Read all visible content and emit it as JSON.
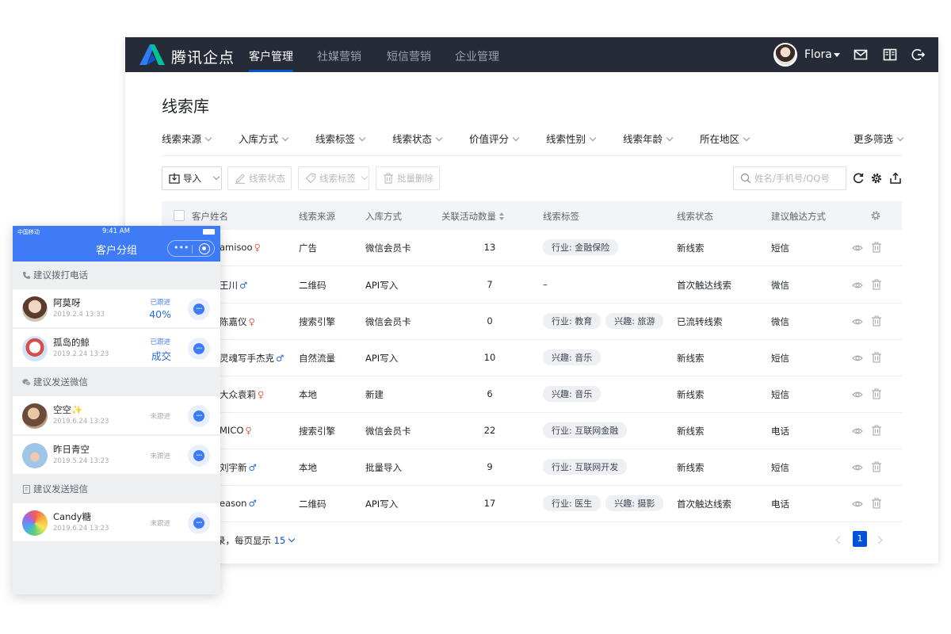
{
  "app": {
    "brand": "腾讯企点",
    "nav_tabs": [
      "客户管理",
      "社媒营销",
      "短信营销",
      "企业管理"
    ],
    "active_tab": "客户管理",
    "user_name": "Flora",
    "accent_color": "#0052d9",
    "nav_bg_color": "#252b37"
  },
  "page": {
    "title": "线索库",
    "filters": [
      "线索来源",
      "入库方式",
      "线索标签",
      "线索状态",
      "价值评分",
      "线索性别",
      "线索年龄",
      "所在地区"
    ],
    "more_filters": "更多筛选",
    "toolbar": {
      "import": "导入",
      "lead_status": "线索状态",
      "lead_tags": "线索标签",
      "batch_delete": "批量删除"
    },
    "search_placeholder": "姓名/手机号/QQ号"
  },
  "table": {
    "headers": {
      "name": "客户姓名",
      "source": "线索来源",
      "method": "入库方式",
      "activity": "关联活动数量",
      "tags": "线索标签",
      "status": "线索状态",
      "contact": "建议触达方式"
    },
    "rows": [
      {
        "name": "amisoo",
        "gender": "♀",
        "source": "广告",
        "method": "微信会员卡",
        "activity": "13",
        "tags": [
          "行业: 金融保险"
        ],
        "status": "新线索",
        "contact": "短信"
      },
      {
        "name": "王川",
        "gender": "♂",
        "source": "二维码",
        "method": "API写入",
        "activity": "7",
        "tags": [],
        "empty_tag": "–",
        "status": "首次触达线索",
        "contact": "微信"
      },
      {
        "name": "陈嘉仪",
        "gender": "♀",
        "source": "搜索引擎",
        "method": "微信会员卡",
        "activity": "0",
        "tags": [
          "行业: 教育",
          "兴趣: 旅游"
        ],
        "status": "已流转线索",
        "contact": "微信"
      },
      {
        "name": "灵魂写手杰克",
        "gender": "♂",
        "source": "自然流量",
        "method": "API写入",
        "activity": "10",
        "tags": [
          "兴趣: 音乐"
        ],
        "status": "新线索",
        "contact": "短信"
      },
      {
        "name": "大众袁莉",
        "gender": "♀",
        "source": "本地",
        "method": "新建",
        "activity": "6",
        "tags": [
          "兴趣: 音乐"
        ],
        "status": "新线索",
        "contact": "短信"
      },
      {
        "name": "MICO",
        "gender": "♀",
        "source": "搜索引擎",
        "method": "微信会员卡",
        "activity": "22",
        "tags": [
          "行业: 互联网金融"
        ],
        "status": "新线索",
        "contact": "电话"
      },
      {
        "name": "刘宇新",
        "gender": "♂",
        "source": "本地",
        "method": "批量导入",
        "activity": "9",
        "tags": [
          "行业: 互联网开发"
        ],
        "status": "新线索",
        "contact": "短信"
      },
      {
        "name": "eason",
        "gender": "♂",
        "source": "二维码",
        "method": "API写入",
        "activity": "17",
        "tags": [
          "行业: 医生",
          "兴趣: 摄影"
        ],
        "status": "首次触达线索",
        "contact": "电话"
      }
    ]
  },
  "pagination": {
    "summary": "录，每页显示",
    "page_size": "15",
    "current_page": "1"
  },
  "phone": {
    "carrier": "中国移动",
    "time": "9:41 AM",
    "title": "客户分组",
    "header_color": "#3e7bf6",
    "sections": [
      {
        "label": "建议拨打电话",
        "icon": "phone-icon",
        "items": [
          {
            "name": "阿莫呀",
            "date": "2019.2.4 13:33",
            "status_small": "已跟进",
            "status_big": "40%"
          },
          {
            "name": "孤岛的鲸",
            "date": "2019.2.24 13:23",
            "status_small": "已跟进",
            "status_big": "成交"
          }
        ]
      },
      {
        "label": "建议发送微信",
        "icon": "wechat-icon",
        "items": [
          {
            "name": "空空✨",
            "date": "2019.6.24 13:23",
            "status": "未跟进"
          },
          {
            "name": "昨日青空",
            "date": "2019.5.24 13:23",
            "status": "未跟进"
          }
        ]
      },
      {
        "label": "建议发送短信",
        "icon": "sms-icon",
        "items": [
          {
            "name": "Candy糖",
            "date": "2019.6.24 13:23",
            "status": "未跟进"
          }
        ]
      }
    ]
  }
}
